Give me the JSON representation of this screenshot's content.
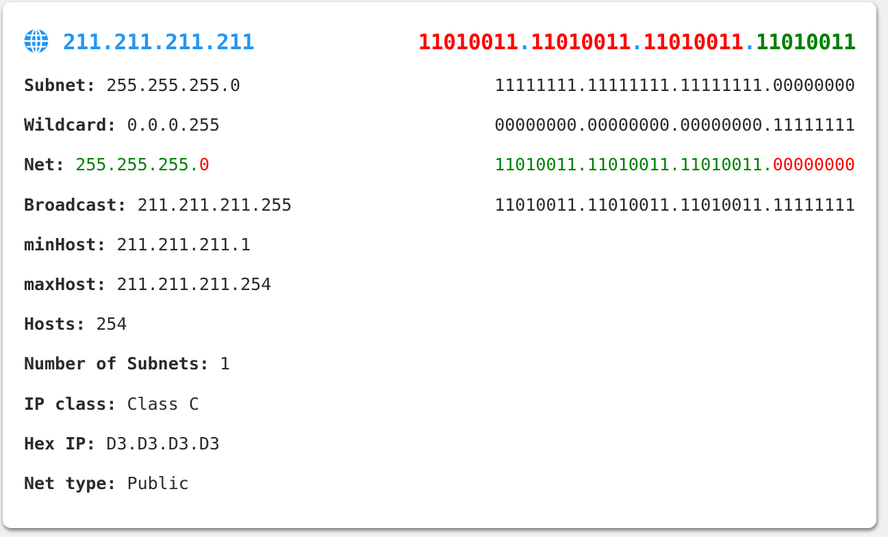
{
  "colors": {
    "accent_blue": "#2196f3",
    "net_red": "#ff0000",
    "host_green": "#008000",
    "text": "#2a2a2a"
  },
  "header": {
    "icon": "globe-icon",
    "ip": "211.211.211.211",
    "binary_octets": [
      "11010011",
      "11010011",
      "11010011",
      "11010011"
    ],
    "dot": "."
  },
  "info": [
    {
      "label": "Subnet:",
      "value": "255.255.255.0"
    },
    {
      "label": "Wildcard:",
      "value": "0.0.0.255"
    },
    {
      "label": "Net:",
      "value_green": "255.255.255.",
      "value_red": "0"
    },
    {
      "label": "Broadcast:",
      "value": "211.211.211.255"
    },
    {
      "label": "minHost:",
      "value": "211.211.211.1"
    },
    {
      "label": "maxHost:",
      "value": "211.211.211.254"
    },
    {
      "label": "Hosts:",
      "value": "254"
    },
    {
      "label": "Number of Subnets:",
      "value": "1"
    },
    {
      "label": "IP class:",
      "value": "Class C"
    },
    {
      "label": "Hex IP:",
      "value": "D3.D3.D3.D3"
    },
    {
      "label": "Net type:",
      "value": "Public"
    }
  ],
  "binary": {
    "subnet": "11111111.11111111.11111111.00000000",
    "wildcard": "00000000.00000000.00000000.11111111",
    "net_green": "11010011.11010011.11010011.",
    "net_red": "00000000",
    "broadcast": "11010011.11010011.11010011.11111111"
  }
}
